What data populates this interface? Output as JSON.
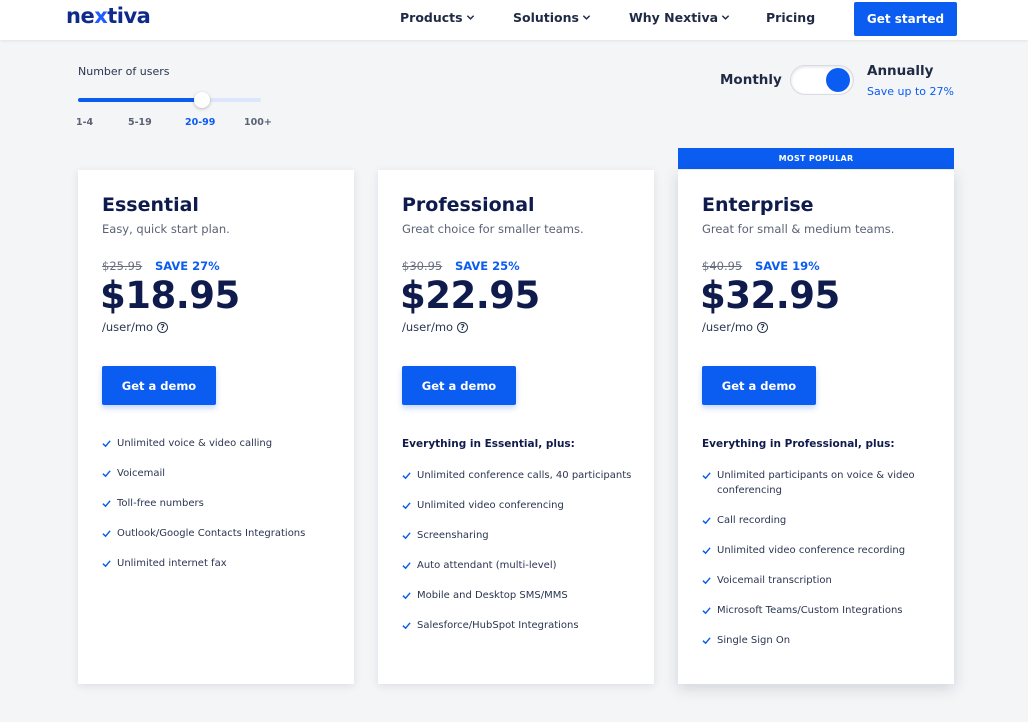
{
  "header": {
    "logo": {
      "prefix": "ne",
      "x": "x",
      "suffix": "tiva"
    },
    "nav": [
      {
        "label": "Products",
        "dropdown": true
      },
      {
        "label": "Solutions",
        "dropdown": true
      },
      {
        "label": "Why Nextiva",
        "dropdown": true
      },
      {
        "label": "Pricing",
        "dropdown": false
      }
    ],
    "cta_label": "Get started"
  },
  "users": {
    "label": "Number of users",
    "ticks": [
      "1-4",
      "5-19",
      "20-99",
      "100+"
    ],
    "selected_index": 2,
    "slider_level": 0.68
  },
  "billing": {
    "monthly_label": "Monthly",
    "annually_label": "Annually",
    "save_note": "Save up to 27%",
    "selected": "Annually"
  },
  "popular_banner": "MOST POPULAR",
  "plans": [
    {
      "name": "Essential",
      "tagline": "Easy, quick start plan.",
      "old_price": "$25.95",
      "save": "SAVE 27%",
      "price": "$18.95",
      "unit": "/user/mo",
      "cta": "Get a demo",
      "features_head": "",
      "features": [
        "Unlimited voice & video calling",
        "Voicemail",
        "Toll-free numbers",
        "Outlook/Google Contacts Integrations",
        "Unlimited internet fax"
      ]
    },
    {
      "name": "Professional",
      "tagline": "Great choice for smaller teams.",
      "old_price": "$30.95",
      "save": "SAVE 25%",
      "price": "$22.95",
      "unit": "/user/mo",
      "cta": "Get a demo",
      "features_head": "Everything in Essential, plus:",
      "features": [
        "Unlimited conference calls, 40 participants",
        "Unlimited video conferencing",
        "Screensharing",
        "Auto attendant (multi-level)",
        "Mobile and Desktop SMS/MMS",
        "Salesforce/HubSpot Integrations"
      ]
    },
    {
      "name": "Enterprise",
      "tagline": "Great for small & medium teams.",
      "old_price": "$40.95",
      "save": "SAVE 19%",
      "price": "$32.95",
      "unit": "/user/mo",
      "cta": "Get a demo",
      "features_head": "Everything in Professional, plus:",
      "features": [
        "Unlimited participants on voice & video conferencing",
        "Call recording",
        "Unlimited video conference recording",
        "Voicemail transcription",
        "Microsoft Teams/Custom Integrations",
        "Single Sign On"
      ]
    }
  ],
  "colors": {
    "brand_blue": "#0b5cf0",
    "navy": "#0f1b4c",
    "background": "#f4f5f7"
  }
}
